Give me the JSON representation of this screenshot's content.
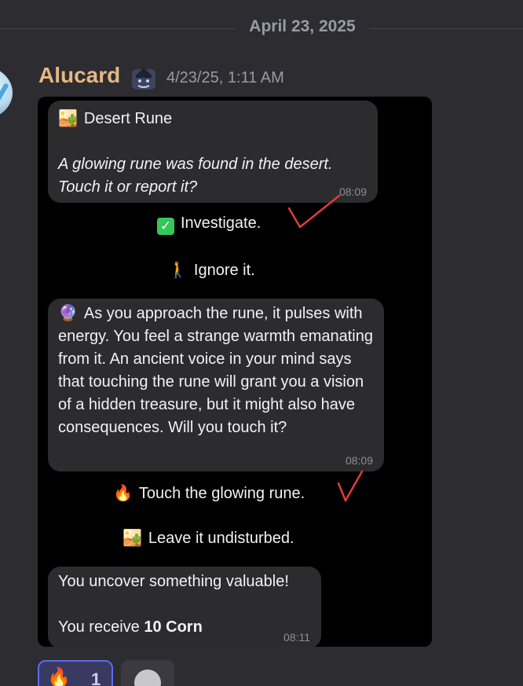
{
  "date_divider": "April 23, 2025",
  "message": {
    "username": "Alucard",
    "timestamp": "4/23/25, 1:11 AM"
  },
  "screenshot": {
    "bubble1": {
      "title_emoji": "🏜️",
      "title": "Desert Rune",
      "body": "A glowing rune was found in the desert. Touch it or report it?",
      "time": "08:09"
    },
    "choices1": [
      {
        "emoji": "✓",
        "label": "Investigate."
      },
      {
        "emoji": "🚶",
        "label": "Ignore it."
      }
    ],
    "bubble2": {
      "emoji": "🔮",
      "body": "As you approach the rune, it pulses with energy. You feel a strange warmth emanating from it. An ancient voice in your mind says that touching the rune will grant you a vision of a hidden treasure, but it might also have consequences. Will you touch it?",
      "time": "08:09"
    },
    "choices2": [
      {
        "emoji": "🔥",
        "label": "Touch the glowing rune."
      },
      {
        "emoji": "🏜️",
        "label": "Leave it undisturbed."
      }
    ],
    "bubble3": {
      "line1": "You uncover something valuable!",
      "line2_prefix": "You receive ",
      "line2_bold": "10 Corn",
      "time": "08:11"
    },
    "annotation_color": "#e23b3b"
  },
  "reactions": [
    {
      "emoji": "🔥",
      "count": "1",
      "icon": "fire-icon"
    }
  ],
  "add_reaction_icon": "smiley-add-icon"
}
